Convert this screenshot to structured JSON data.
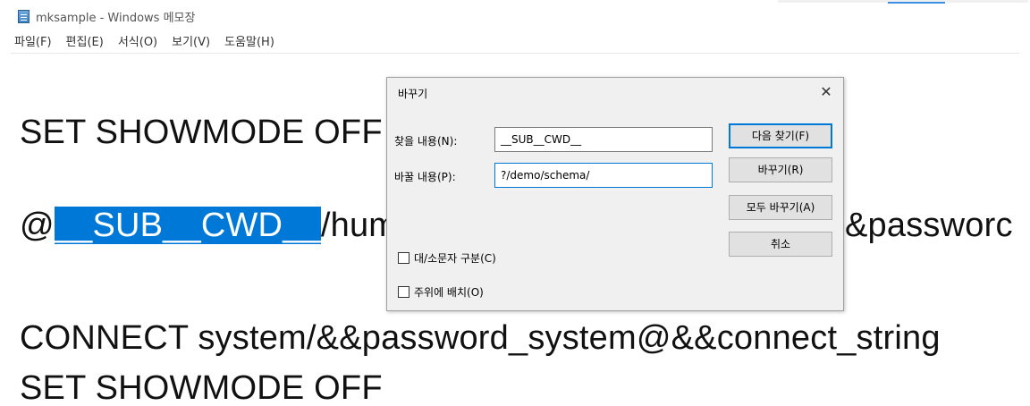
{
  "window": {
    "title": "mksample - Windows 메모장"
  },
  "menu": {
    "items": [
      "파일(F)",
      "편집(E)",
      "서식(O)",
      "보기(V)",
      "도움말(H)"
    ]
  },
  "editor": {
    "line1": "SET SHOWMODE OFF",
    "line2_prefix": "@",
    "line2_selected": "__SUB__CWD__",
    "line2_suffix": "/hum",
    "line2_tail": "&passworc",
    "line3": "CONNECT system/&&password_system@&&connect_string",
    "line4": "SET SHOWMODE OFF"
  },
  "dialog": {
    "title": "바꾸기",
    "close_glyph": "✕",
    "find_label": "찾을 내용(N):",
    "find_value": "__SUB__CWD__",
    "replace_label": "바꿀 내용(P):",
    "replace_value": "?/demo/schema/",
    "find_next_button": "다음 찾기(F)",
    "replace_button": "바꾸기(R)",
    "replace_all_button": "모두 바꾸기(A)",
    "cancel_button": "취소",
    "match_case_label": "대/소문자 구분(C)",
    "wrap_around_label": "주위에 배치(O)",
    "match_case_checked": false,
    "wrap_around_checked": false
  },
  "colors": {
    "selection": "#0078d7",
    "dialog_bg": "#f0f0f0",
    "focus_border": "#0078d7"
  }
}
